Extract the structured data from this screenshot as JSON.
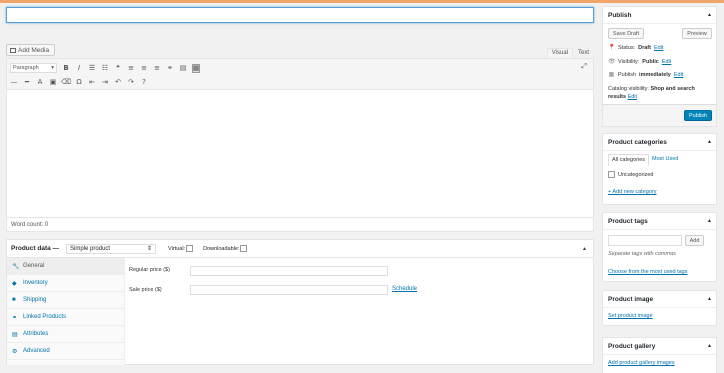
{
  "editor": {
    "add_media_label": "Add Media",
    "tab_visual": "Visual",
    "tab_text": "Text",
    "format_select": "Paragraph",
    "toolbar_row1": [
      {
        "name": "bold-button",
        "glyph": "B"
      },
      {
        "name": "italic-button",
        "glyph": "I"
      },
      {
        "name": "bullet-list-button",
        "glyph": "☰"
      },
      {
        "name": "numbered-list-button",
        "glyph": "☷"
      },
      {
        "name": "blockquote-button",
        "glyph": "❝"
      },
      {
        "name": "align-left-button",
        "glyph": "≡"
      },
      {
        "name": "align-center-button",
        "glyph": "≡"
      },
      {
        "name": "align-right-button",
        "glyph": "≡"
      },
      {
        "name": "insert-link-button",
        "glyph": "⚭"
      },
      {
        "name": "read-more-button",
        "glyph": "▤"
      },
      {
        "name": "toolbar-toggle-button",
        "glyph": "▦"
      }
    ],
    "toolbar_row2": [
      {
        "name": "strikethrough-button",
        "glyph": "—"
      },
      {
        "name": "horizontal-line-button",
        "glyph": "━"
      },
      {
        "name": "text-color-button",
        "glyph": "A"
      },
      {
        "name": "paste-text-button",
        "glyph": "▣"
      },
      {
        "name": "clear-formatting-button",
        "glyph": "⌫"
      },
      {
        "name": "special-character-button",
        "glyph": "Ω"
      },
      {
        "name": "decrease-indent-button",
        "glyph": "⇤"
      },
      {
        "name": "increase-indent-button",
        "glyph": "⇥"
      },
      {
        "name": "undo-button",
        "glyph": "↶"
      },
      {
        "name": "redo-button",
        "glyph": "↷"
      },
      {
        "name": "help-button",
        "glyph": "?"
      }
    ],
    "word_count": "Word count: 0"
  },
  "product_data": {
    "title": "Product data —",
    "type_select": "Simple product",
    "virtual_label": "Virtual:",
    "downloadable_label": "Downloadable:",
    "tabs": [
      {
        "label": "General",
        "icon": "wrench-icon",
        "glyph": "🔧"
      },
      {
        "label": "Inventory",
        "icon": "diamond-icon",
        "glyph": "◆"
      },
      {
        "label": "Shipping",
        "icon": "truck-icon",
        "glyph": "■"
      },
      {
        "label": "Linked Products",
        "icon": "link-icon",
        "glyph": "⚭"
      },
      {
        "label": "Attributes",
        "icon": "table-icon",
        "glyph": "▤"
      },
      {
        "label": "Advanced",
        "icon": "gear-icon",
        "glyph": "⚙"
      }
    ],
    "regular_price_label": "Regular price ($)",
    "sale_price_label": "Sale price ($)",
    "schedule_link": "Schedule"
  },
  "publish": {
    "title": "Publish",
    "save_draft": "Save Draft",
    "preview": "Preview",
    "status_label": "Status:",
    "status_value": "Draft",
    "visibility_label": "Visibility:",
    "visibility_value": "Public",
    "publish_label": "Publish",
    "publish_value": "immediately",
    "catalog_label": "Catalog visibility:",
    "catalog_value": "Shop and search results",
    "edit": "Edit",
    "publish_button": "Publish"
  },
  "categories": {
    "title": "Product categories",
    "tab_all": "All categories",
    "tab_most_used": "Most Used",
    "items": [
      "Uncategorized"
    ],
    "add_new": "+ Add new category"
  },
  "tags": {
    "title": "Product tags",
    "add_button": "Add",
    "hint": "Separate tags with commas",
    "choose_link": "Choose from the most used tags"
  },
  "image": {
    "title": "Product image",
    "link": "Set product image"
  },
  "gallery": {
    "title": "Product gallery",
    "link": "Add product gallery images"
  },
  "colors": {
    "accent": "#0073aa",
    "primary_button": "#0085ba",
    "top_bar": "#f0a56a"
  }
}
